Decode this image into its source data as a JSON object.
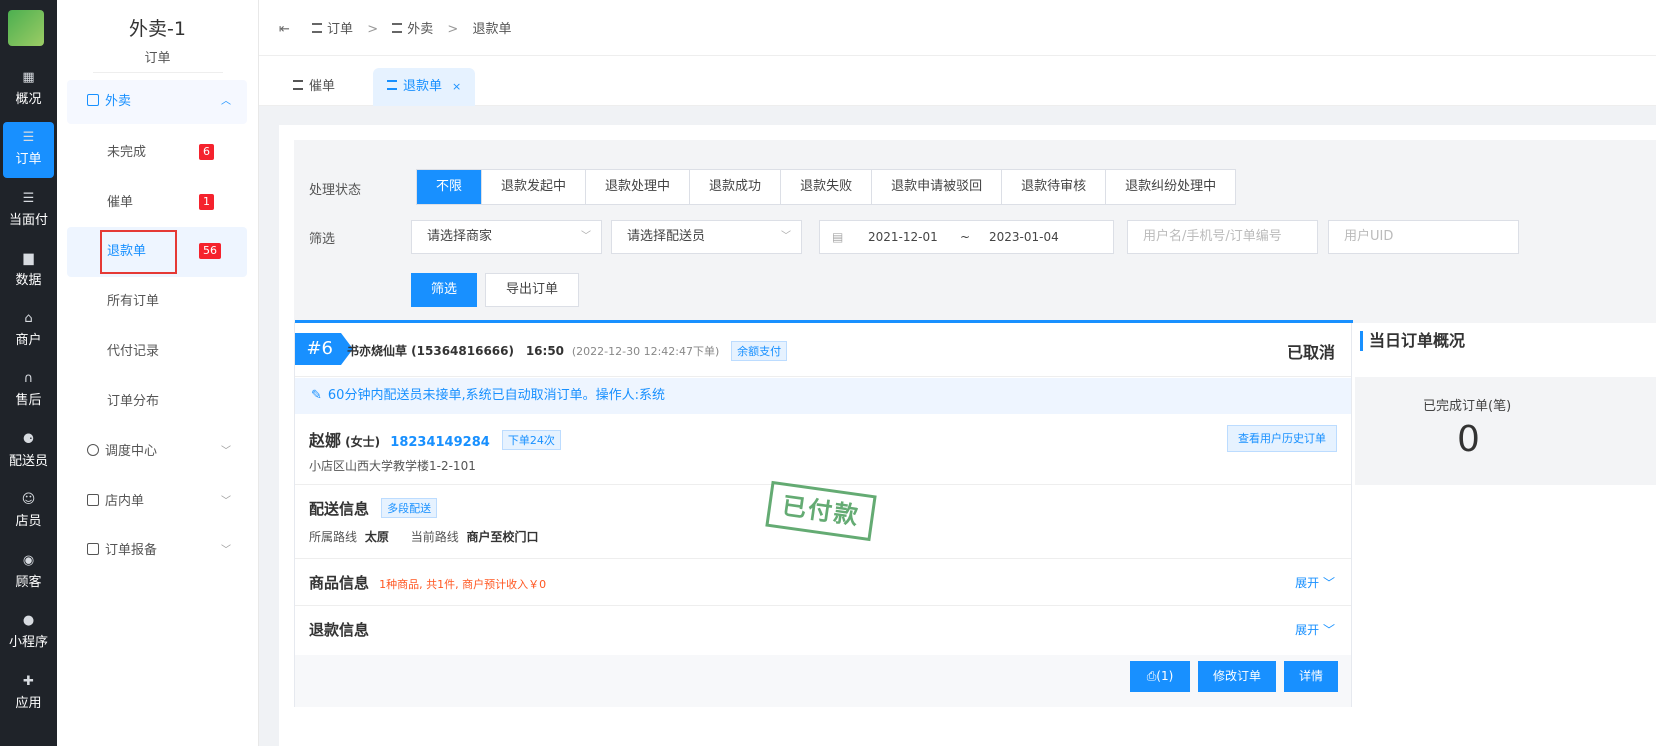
{
  "rail": {
    "items": [
      {
        "label": "概况",
        "icon": "dashboard-icon"
      },
      {
        "label": "订单",
        "icon": "list-icon",
        "active": true
      },
      {
        "label": "当面付",
        "icon": "list-icon"
      },
      {
        "label": "数据",
        "icon": "bar-chart-icon"
      },
      {
        "label": "商户",
        "icon": "store-icon"
      },
      {
        "label": "售后",
        "icon": "headset-icon"
      },
      {
        "label": "配送员",
        "icon": "scooter-icon"
      },
      {
        "label": "店员",
        "icon": "staff-icon"
      },
      {
        "label": "顾客",
        "icon": "customer-icon"
      },
      {
        "label": "小程序",
        "icon": "wechat-icon"
      },
      {
        "label": "应用",
        "icon": "apps-icon"
      }
    ]
  },
  "subnav": {
    "title": "外卖-1",
    "subtitle": "订单",
    "groups": [
      {
        "label": "外卖",
        "icon": "document-icon",
        "open": true
      },
      {
        "label": "调度中心",
        "icon": "location-icon"
      },
      {
        "label": "店内单",
        "icon": "document-icon"
      },
      {
        "label": "订单报备",
        "icon": "document-icon"
      }
    ],
    "items": [
      {
        "label": "未完成",
        "badge": "6"
      },
      {
        "label": "催单",
        "badge": "1"
      },
      {
        "label": "退款单",
        "badge": "56",
        "selected": true
      },
      {
        "label": "所有订单"
      },
      {
        "label": "代付记录"
      },
      {
        "label": "订单分布"
      }
    ]
  },
  "breadcrumb": [
    "订单",
    "外卖",
    "退款单"
  ],
  "tabs": [
    {
      "label": "催单"
    },
    {
      "label": "退款单",
      "active": true,
      "close": "×"
    }
  ],
  "filter": {
    "status_label": "处理状态",
    "statuses": [
      "不限",
      "退款发起中",
      "退款处理中",
      "退款成功",
      "退款失败",
      "退款申请被驳回",
      "退款待审核",
      "退款纠纷处理中"
    ],
    "filter_label": "筛选",
    "merchant_placeholder": "请选择商家",
    "courier_placeholder": "请选择配送员",
    "date_start": "2021-12-01",
    "date_sep": "~",
    "date_end": "2023-01-04",
    "search_placeholder": "用户名/手机号/订单编号",
    "uid_placeholder": "用户UID",
    "filter_button": "筛选",
    "export_button": "导出订单"
  },
  "order": {
    "number": "#6",
    "merchant": "书亦烧仙草 (15364816666)",
    "time": "16:50",
    "placed": "(2022-12-30 12:42:47下单)",
    "pay_tag": "余额支付",
    "status": "已取消",
    "notice": "60分钟内配送员未接单,系统已自动取消订单。操作人:系统",
    "customer_name": "赵娜",
    "customer_title": "(女士)",
    "customer_phone": "18234149284",
    "order_count": "下单24次",
    "history_button": "查看用户历史订单",
    "address": "小店区山西大学教学楼1-2-101",
    "delivery_title": "配送信息",
    "delivery_tag": "多段配送",
    "route_label": "所属路线",
    "route_value": "太原",
    "current_route_label": "当前路线",
    "current_route_value": "商户至校门口",
    "stamp": "已付款",
    "goods_title": "商品信息",
    "goods_summary": "1种商品, 共1件, 商户预计收入￥0",
    "expand": "展开",
    "refund_title": "退款信息",
    "print_button": "(1)",
    "edit_button": "修改订单",
    "detail_button": "详情"
  },
  "summary": {
    "title": "当日订单概况",
    "completed_label": "已完成订单(笔)",
    "completed_value": "0"
  }
}
